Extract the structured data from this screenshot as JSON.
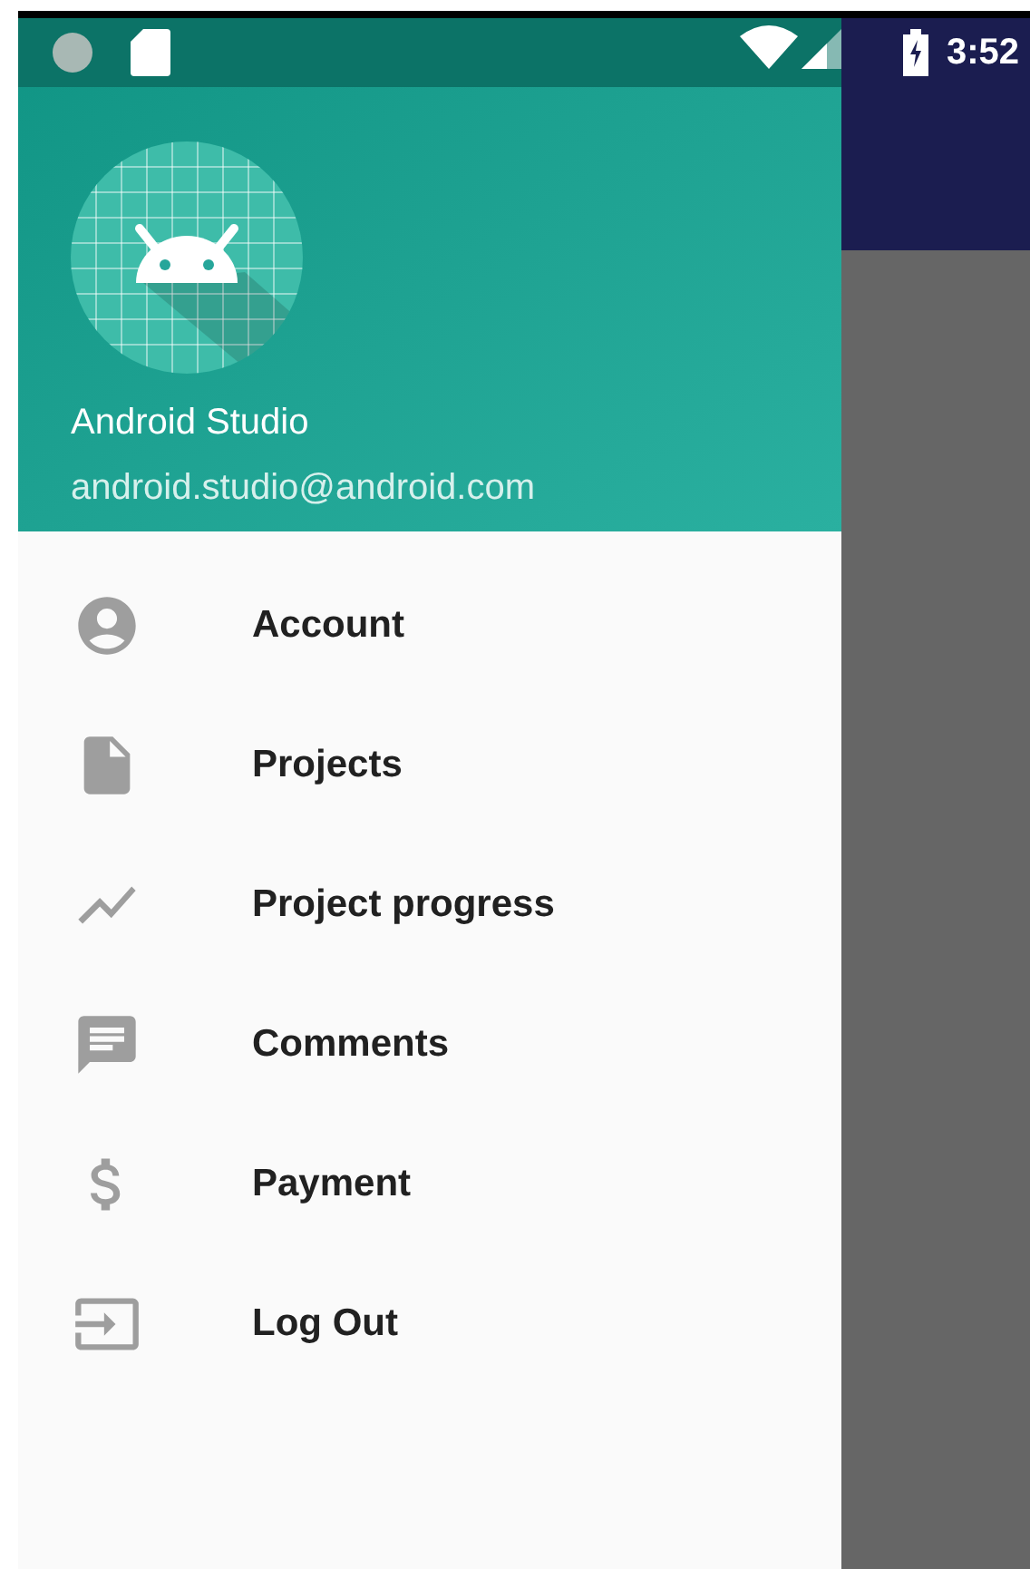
{
  "status_bar": {
    "time": "3:52"
  },
  "drawer_header": {
    "name": "Android Studio",
    "email": "android.studio@android.com"
  },
  "menu": [
    {
      "kind": "account",
      "label": "Account"
    },
    {
      "kind": "file",
      "label": "Projects"
    },
    {
      "kind": "chart",
      "label": "Project progress"
    },
    {
      "kind": "comment",
      "label": "Comments"
    },
    {
      "kind": "money",
      "label": "Payment"
    },
    {
      "kind": "logout",
      "label": "Log Out"
    }
  ]
}
